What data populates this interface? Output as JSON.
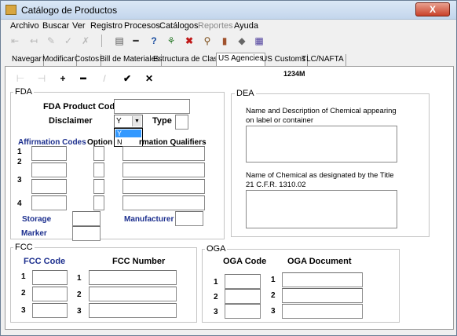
{
  "window": {
    "title": "Catálogo de Productos",
    "close": "X"
  },
  "menu": [
    "Archivo",
    "Buscar",
    "Ver",
    "Registro",
    "Procesos",
    "Catálogos",
    "Reportes",
    "Ayuda"
  ],
  "tabs": [
    "Navegar",
    "Modificar",
    "Costos",
    "Bill de Materiales",
    "Estructura de Clases",
    "US Agencies",
    "US Customs",
    "TLC/NAFTA"
  ],
  "active_tab": "US Agencies",
  "record_id": "1234M",
  "fda": {
    "title": "FDA",
    "product_code_label": "FDA Product Code",
    "product_code_value": "",
    "disclaimer_label": "Disclaimer",
    "disclaimer_value": "Y",
    "disclaimer_options": [
      "Y",
      "N"
    ],
    "type_label": "Type",
    "type_value": "",
    "affirmation_codes_label": "Affirmation Codes",
    "option_label": "Option",
    "qualifiers_label": "rmation Qualifiers",
    "row_numbers": [
      "1",
      "2",
      "3",
      "4"
    ],
    "storage_label": "Storage",
    "manufacturer_label": "Manufacturer",
    "marker_label": "Marker"
  },
  "dea": {
    "title": "DEA",
    "chemical_name_label": "Name and Description of Chemical appearing on label or container",
    "chemical_cfr_label": "Name of Chemical as designated by the Title 21 C.F.R. 1310.02"
  },
  "fcc": {
    "title": "FCC",
    "code_label": "FCC Code",
    "number_label": "FCC Number",
    "row_numbers": [
      "1",
      "2",
      "3"
    ]
  },
  "oga": {
    "title": "OGA",
    "code_label": "OGA Code",
    "document_label": "OGA Document",
    "row_numbers": [
      "1",
      "2",
      "3"
    ]
  },
  "colors": {
    "title_gradient": "#c3d6ec",
    "blue_label": "#1c2f8e",
    "close_button": "#c9412a",
    "selection": "#3399ff"
  }
}
